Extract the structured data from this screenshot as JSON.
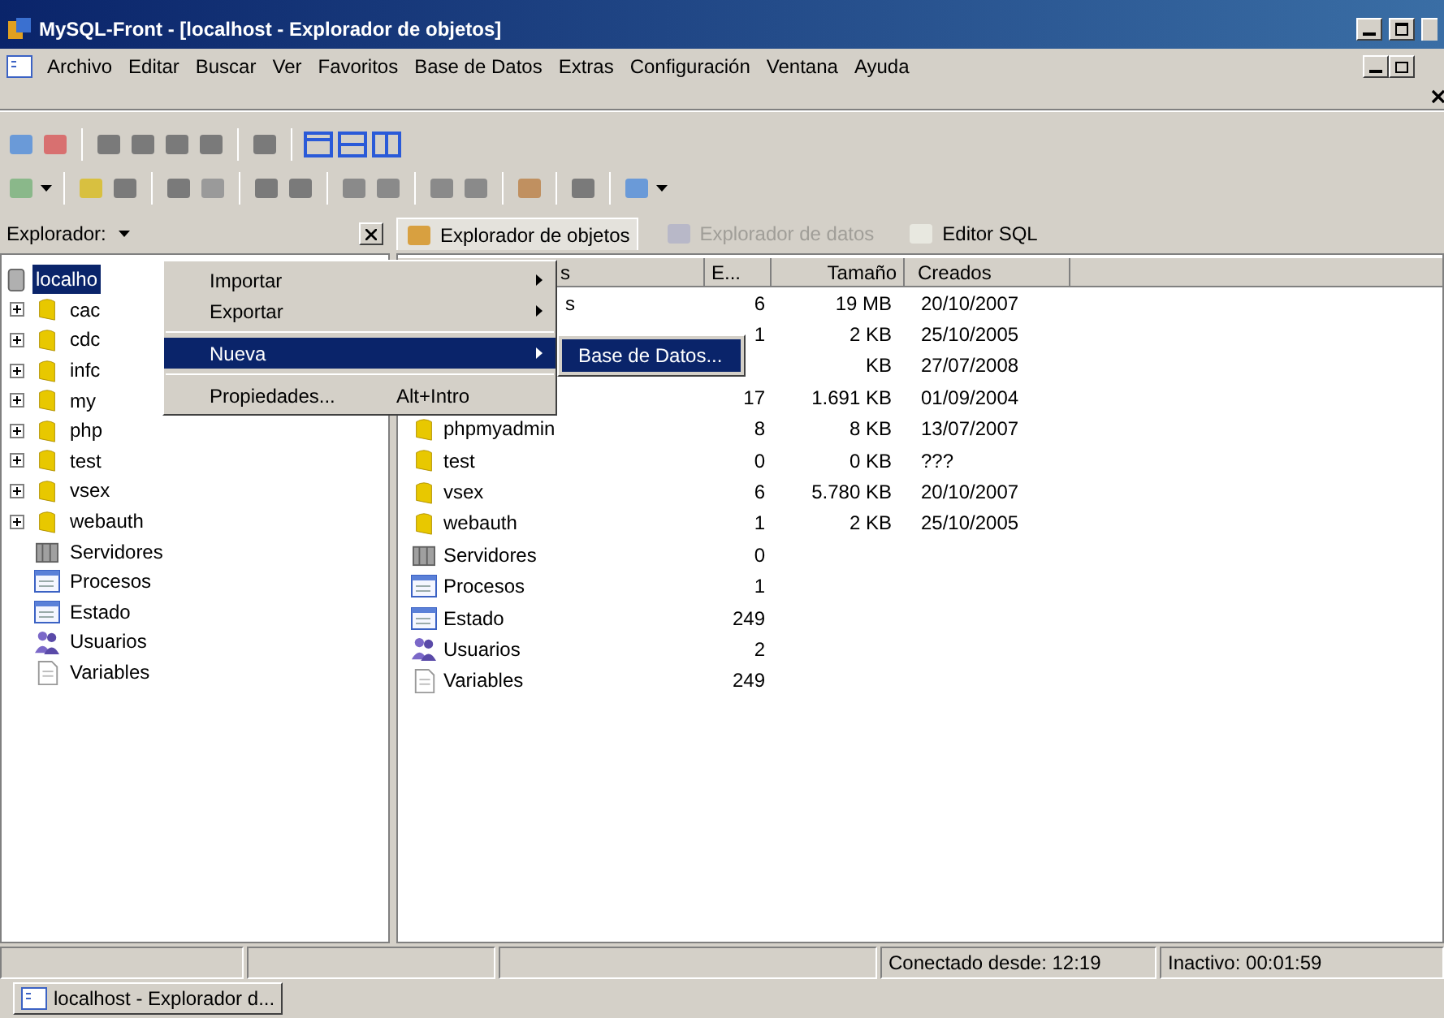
{
  "window": {
    "title": "MySQL-Front - [localhost - Explorador de objetos]"
  },
  "menu": [
    "Archivo",
    "Editar",
    "Buscar",
    "Ver",
    "Favoritos",
    "Base de Datos",
    "Extras",
    "Configuración",
    "Ventana",
    "Ayuda"
  ],
  "left_panel": {
    "title": "Explorador:"
  },
  "tabs": [
    {
      "label": "Explorador de objetos",
      "selected": true,
      "disabled": false
    },
    {
      "label": "Explorador de datos",
      "selected": false,
      "disabled": true
    },
    {
      "label": "Editor SQL",
      "selected": false,
      "disabled": false
    }
  ],
  "tree": {
    "label": "localho",
    "selected": true,
    "children": [
      {
        "label": "cac",
        "kind": "database",
        "expanded": false
      },
      {
        "label": "cdc",
        "kind": "database",
        "expanded": false
      },
      {
        "label": "infc",
        "kind": "database",
        "expanded": false
      },
      {
        "label": "my",
        "kind": "database",
        "expanded": false
      },
      {
        "label": "php",
        "kind": "database",
        "expanded": false
      },
      {
        "label": "test",
        "kind": "database",
        "expanded": false
      },
      {
        "label": "vsex",
        "kind": "database",
        "expanded": false
      },
      {
        "label": "webauth",
        "kind": "database",
        "expanded": false
      },
      {
        "label": "Servidores",
        "kind": "servers"
      },
      {
        "label": "Procesos",
        "kind": "processes"
      },
      {
        "label": "Estado",
        "kind": "status"
      },
      {
        "label": "Usuarios",
        "kind": "users"
      },
      {
        "label": "Variables",
        "kind": "variables"
      }
    ]
  },
  "table": {
    "columns": [
      "s",
      "E...",
      "Tamaño",
      "Creados"
    ],
    "rows": [
      {
        "name": "s",
        "count": "6",
        "size": "19 MB",
        "created": "20/10/2007"
      },
      {
        "count": "1",
        "size": "2 KB",
        "created": "25/10/2005"
      },
      {
        "size": "KB",
        "created": "27/07/2008"
      },
      {
        "count": "17",
        "size": "1.691 KB",
        "created": "01/09/2004"
      },
      {
        "name": "phpmyadmin",
        "kind": "database",
        "count": "8",
        "size": "8 KB",
        "created": "13/07/2007"
      },
      {
        "name": "test",
        "kind": "database",
        "count": "0",
        "size": "0 KB",
        "created": "???"
      },
      {
        "name": "vsex",
        "kind": "database",
        "count": "6",
        "size": "5.780 KB",
        "created": "20/10/2007"
      },
      {
        "name": "webauth",
        "kind": "database",
        "count": "1",
        "size": "2 KB",
        "created": "25/10/2005"
      },
      {
        "name": "Servidores",
        "kind": "servers",
        "count": "0"
      },
      {
        "name": "Procesos",
        "kind": "processes",
        "count": "1"
      },
      {
        "name": "Estado",
        "kind": "status",
        "count": "249"
      },
      {
        "name": "Usuarios",
        "kind": "users",
        "count": "2"
      },
      {
        "name": "Variables",
        "kind": "variables",
        "count": "249"
      }
    ]
  },
  "context_menu": {
    "items": [
      {
        "label": "Importar",
        "submenu": true,
        "selected": false
      },
      {
        "label": "Exportar",
        "submenu": true,
        "selected": false
      },
      {
        "kind": "separator"
      },
      {
        "label": "Nueva",
        "submenu": true,
        "selected": true
      },
      {
        "kind": "separator"
      },
      {
        "label": "Propiedades...",
        "shortcut": "Alt+Intro",
        "submenu": false,
        "selected": false
      }
    ],
    "submenu": [
      {
        "label": "Base de Datos...",
        "selected": true
      }
    ]
  },
  "status_bar": {
    "connected": "Conectado desde: 12:19",
    "idle": "Inactivo: 00:01:59"
  },
  "taskbar": [
    {
      "label": "localhost - Explorador d..."
    }
  ]
}
